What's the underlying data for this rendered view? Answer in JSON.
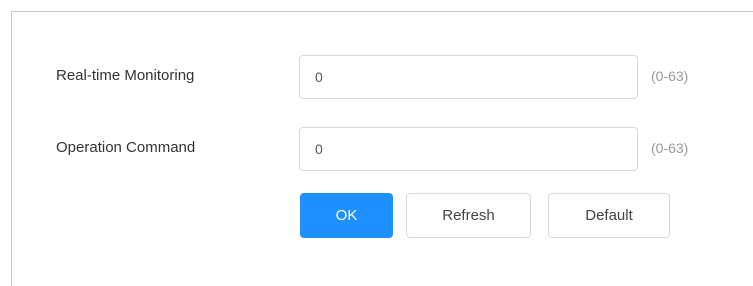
{
  "form": {
    "fields": [
      {
        "label": "Real-time Monitoring",
        "value": "0",
        "range": "(0-63)"
      },
      {
        "label": "Operation Command",
        "value": "0",
        "range": "(0-63)"
      }
    ],
    "buttons": {
      "ok": "OK",
      "refresh": "Refresh",
      "default": "Default"
    }
  },
  "colors": {
    "primary": "#1e90ff",
    "border": "#d9d9d9",
    "range_text": "#999999"
  }
}
